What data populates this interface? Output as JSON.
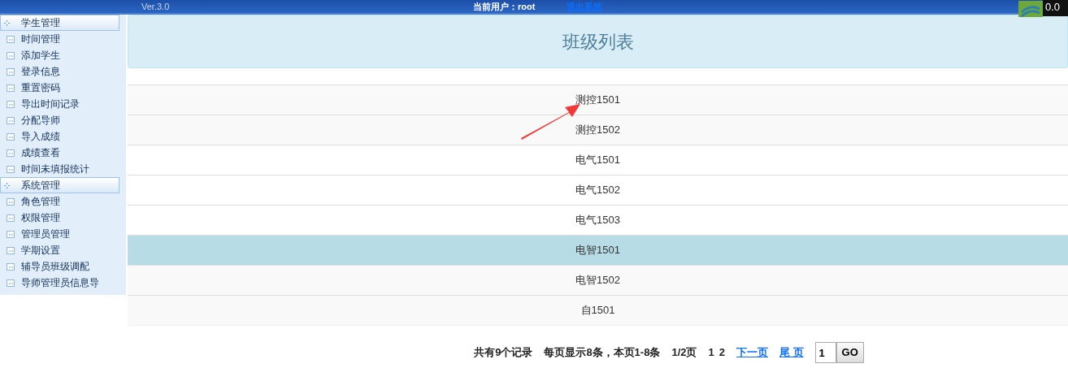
{
  "header": {
    "version": "Ver.3.0",
    "user": "当前用户：root",
    "logout": "退出系统",
    "counter": "0.0"
  },
  "sidebar": {
    "groups": [
      {
        "title": "学生管理",
        "expanded": true,
        "items": [
          "时间管理",
          "添加学生",
          "登录信息",
          "重置密码",
          "导出时间记录",
          "分配导师",
          "导入成绩",
          "成绩查看",
          "时间未填报统计"
        ]
      },
      {
        "title": "系统管理",
        "expanded": true,
        "items": [
          "角色管理",
          "权限管理",
          "管理员管理",
          "学期设置",
          "辅导员班级调配",
          "导师管理员信息导"
        ]
      }
    ]
  },
  "page_title": "班级列表",
  "classes": [
    {
      "name": "测控1501",
      "selected": false
    },
    {
      "name": "测控1502",
      "selected": false
    },
    {
      "name": "电气1501",
      "selected": false
    },
    {
      "name": "电气1502",
      "selected": false
    },
    {
      "name": "电气1503",
      "selected": false
    },
    {
      "name": "电智1501",
      "selected": true
    },
    {
      "name": "电智1502",
      "selected": false
    },
    {
      "name": "自1501",
      "selected": false
    }
  ],
  "pagination": {
    "total": "共有9个记录",
    "per_page": "每页显示8条，本页1-8条",
    "page_of": "1/2页",
    "pages": [
      "1",
      "2"
    ],
    "next": "下一页",
    "last": "尾 页",
    "page_input": "1",
    "go": "GO"
  }
}
